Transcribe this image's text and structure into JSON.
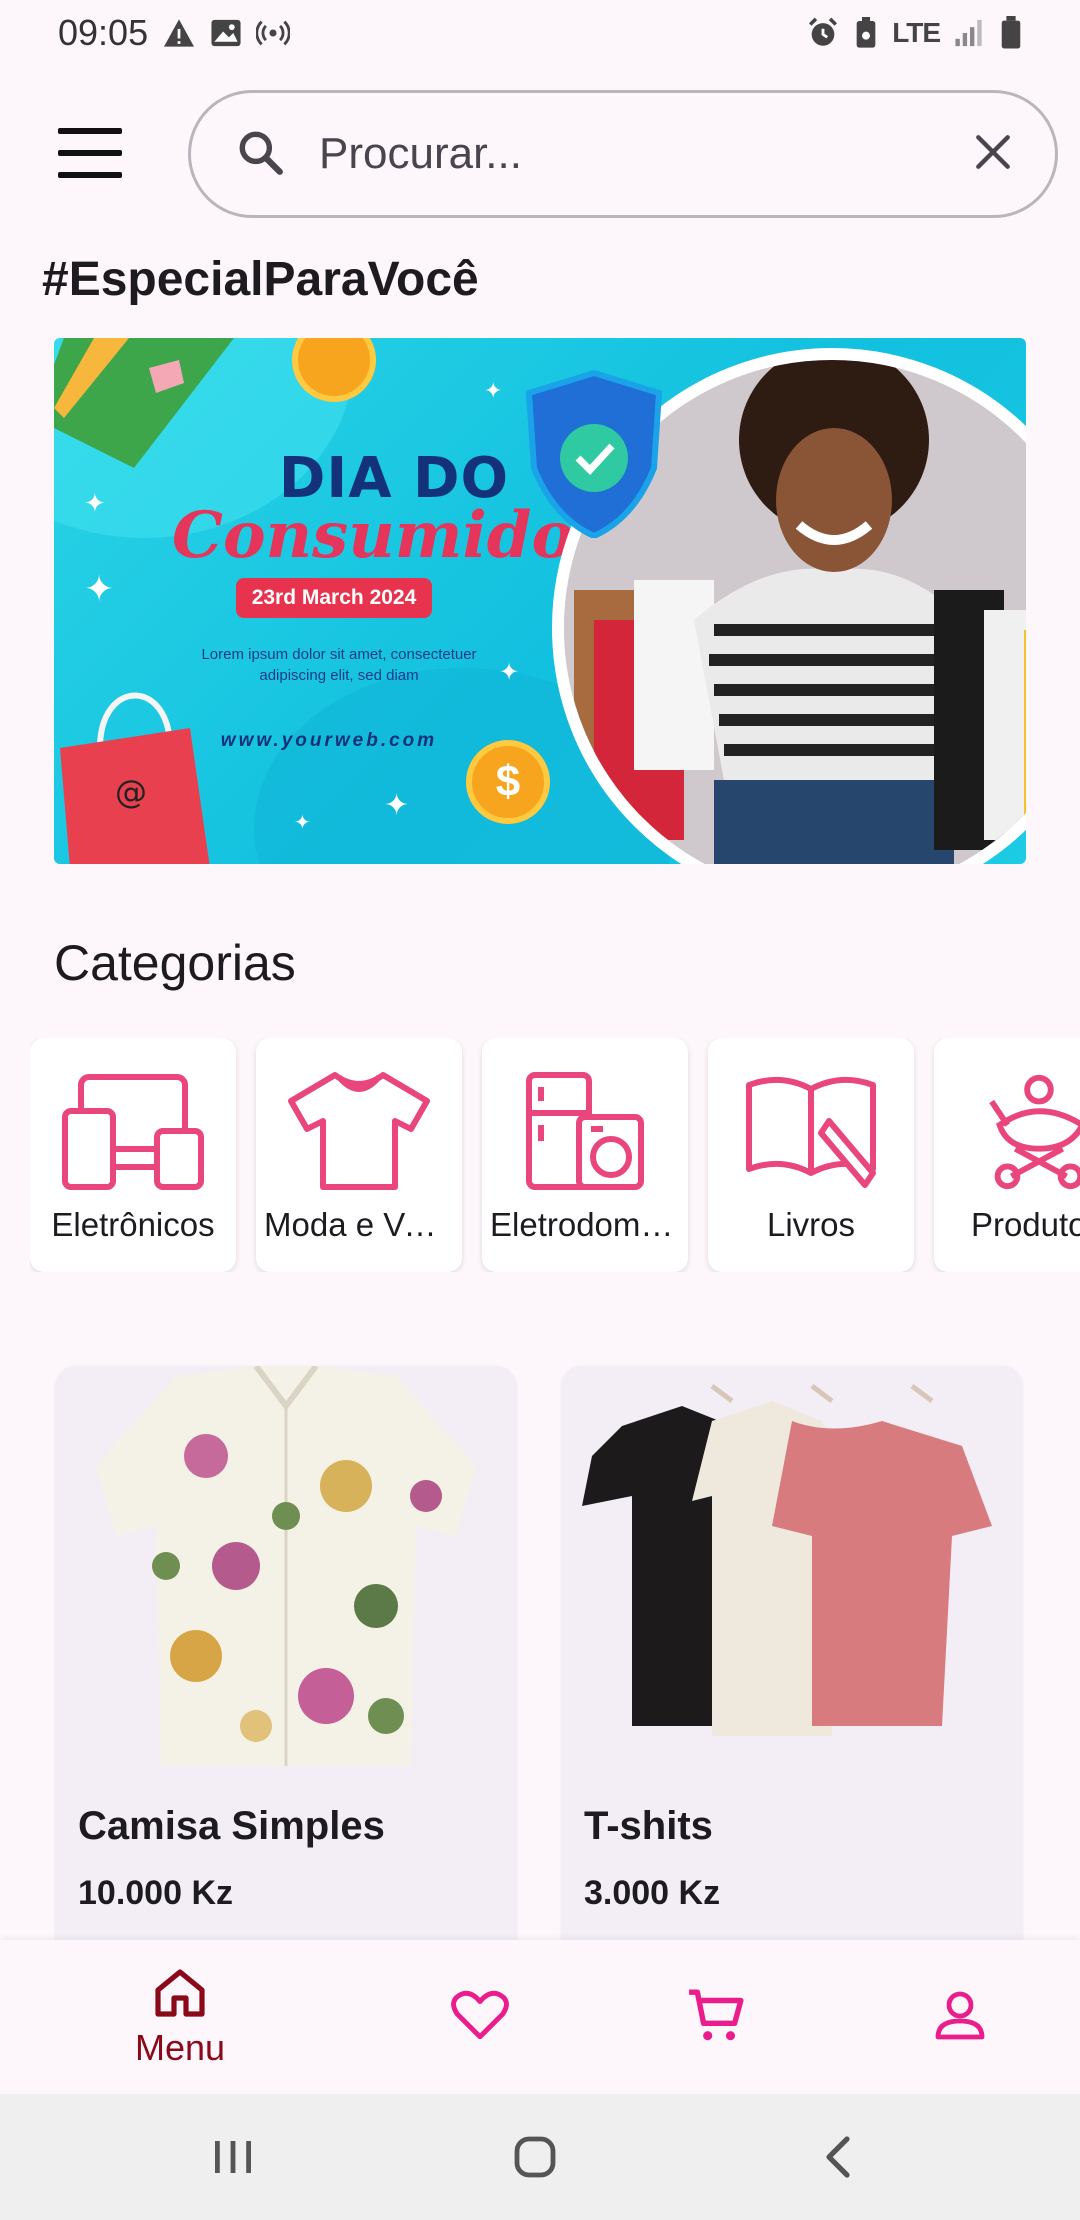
{
  "status_bar": {
    "time": "09:05",
    "left_icons": [
      "warning-icon",
      "image-icon",
      "hotspot-icon"
    ],
    "right_icons": [
      "alarm-icon",
      "battery-saver-icon",
      "lte-icon",
      "signal-icon",
      "battery-icon"
    ],
    "network": "LTE"
  },
  "search": {
    "placeholder": "Procurar...",
    "value": ""
  },
  "special_section": {
    "title": "#EspecialParaVocê"
  },
  "banner": {
    "title": "DIA DO",
    "script": "Consumidor",
    "date_text": "23rd March 2024",
    "lorem": "Lorem ipsum dolor sit amet, consectetuer adipiscing elit, sed diam",
    "website": "www.yourweb.com"
  },
  "categories": {
    "title": "Categorias",
    "items": [
      {
        "label": "Eletrônicos",
        "icon": "devices-icon"
      },
      {
        "label": "Moda e Vestuário",
        "icon": "tshirt-icon"
      },
      {
        "label": "Eletrodomésticos",
        "icon": "appliances-icon"
      },
      {
        "label": "Livros",
        "icon": "book-icon"
      },
      {
        "label": "Produtos",
        "icon": "baby-stroller-icon"
      }
    ]
  },
  "products": [
    {
      "name": "Camisa Simples",
      "price": "10.000 Kz"
    },
    {
      "name": "T-shits",
      "price": "3.000 Kz"
    }
  ],
  "bottom_nav": {
    "items": [
      {
        "label": "Menu",
        "icon": "home-icon",
        "active": true
      },
      {
        "label": "",
        "icon": "heart-icon",
        "active": false
      },
      {
        "label": "",
        "icon": "cart-icon",
        "active": false
      },
      {
        "label": "",
        "icon": "profile-icon",
        "active": false
      }
    ]
  },
  "colors": {
    "accent": "#e91e8c",
    "category_icon": "#e8467c",
    "active_nav": "#8b0a1a",
    "background": "#fdf7fb"
  }
}
